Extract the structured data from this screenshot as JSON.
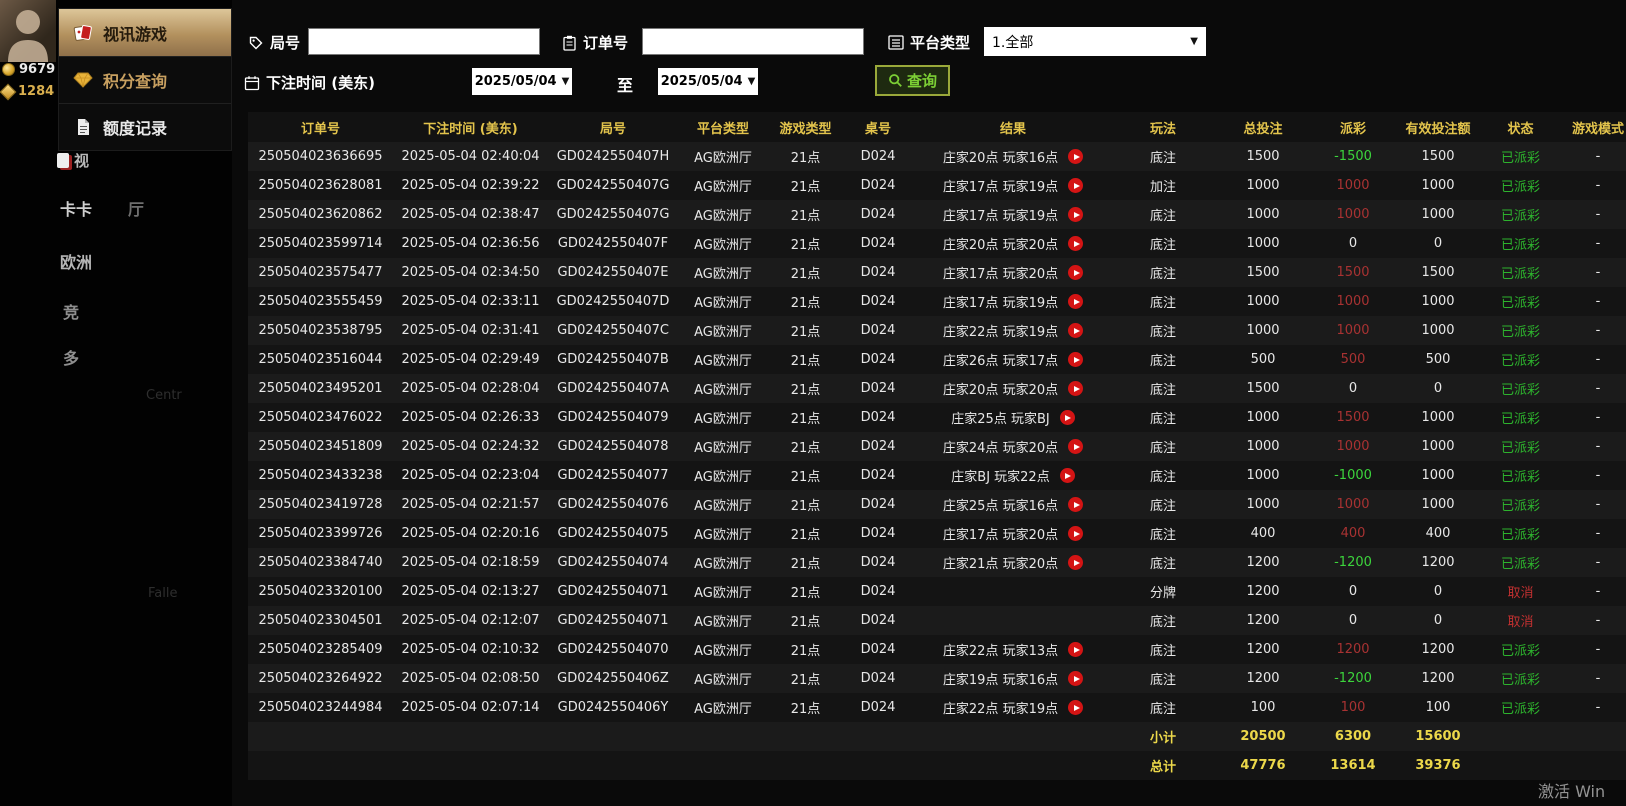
{
  "background": {
    "balances": [
      {
        "icon": "coin-icon",
        "value": "9679"
      },
      {
        "icon": "gem-icon",
        "value": "1284"
      }
    ],
    "nav_fragments": [
      "视",
      "卡卡",
      "厅",
      "欧洲",
      "竞",
      "多"
    ],
    "faint_fragments": [
      "Centr",
      "Falle"
    ]
  },
  "sidebar": {
    "items": [
      {
        "label": "视讯游戏",
        "icon": "cards-icon",
        "active": true
      },
      {
        "label": "积分查询",
        "icon": "diamond-icon",
        "active": false
      },
      {
        "label": "额度记录",
        "icon": "document-icon",
        "active": false
      }
    ]
  },
  "filters": {
    "round": {
      "label": "局号",
      "value": "",
      "icon": "tag-icon"
    },
    "order": {
      "label": "订单号",
      "value": "",
      "icon": "clipboard-icon"
    },
    "platform": {
      "label": "平台类型",
      "value": "1.全部",
      "icon": "list-icon"
    },
    "bet_time": {
      "label": "下注时间 (美东)",
      "icon": "calendar-icon"
    },
    "date_from": "2025/05/04",
    "to_label": "至",
    "date_to": "2025/05/04",
    "search": {
      "label": "查询",
      "icon": "search-icon"
    }
  },
  "table": {
    "headers": [
      "订单号",
      "下注时间 (美东)",
      "局号",
      "平台类型",
      "游戏类型",
      "桌号",
      "结果",
      "玩法",
      "总投注",
      "派彩",
      "有效投注额",
      "状态",
      "游戏模式"
    ],
    "rows": [
      {
        "order": "250504023636695",
        "time": "2025-05-04 02:40:04",
        "round": "GD0242550407H",
        "platform": "AG欧洲厅",
        "game": "21点",
        "table_no": "D024",
        "result": "庄家20点 玩家16点",
        "replay": true,
        "play": "底注",
        "total_bet": "1500",
        "payout": "-1500",
        "payout_class": "loss",
        "valid_bet": "1500",
        "status": "已派彩",
        "status_class": "paid",
        "mode": "-"
      },
      {
        "order": "250504023628081",
        "time": "2025-05-04 02:39:22",
        "round": "GD0242550407G",
        "platform": "AG欧洲厅",
        "game": "21点",
        "table_no": "D024",
        "result": "庄家17点 玩家19点",
        "replay": true,
        "play": "加注",
        "total_bet": "1000",
        "payout": "1000",
        "payout_class": "win",
        "valid_bet": "1000",
        "status": "已派彩",
        "status_class": "paid",
        "mode": "-"
      },
      {
        "order": "250504023620862",
        "time": "2025-05-04 02:38:47",
        "round": "GD0242550407G",
        "platform": "AG欧洲厅",
        "game": "21点",
        "table_no": "D024",
        "result": "庄家17点 玩家19点",
        "replay": true,
        "play": "底注",
        "total_bet": "1000",
        "payout": "1000",
        "payout_class": "win",
        "valid_bet": "1000",
        "status": "已派彩",
        "status_class": "paid",
        "mode": "-"
      },
      {
        "order": "250504023599714",
        "time": "2025-05-04 02:36:56",
        "round": "GD0242550407F",
        "platform": "AG欧洲厅",
        "game": "21点",
        "table_no": "D024",
        "result": "庄家20点 玩家20点",
        "replay": true,
        "play": "底注",
        "total_bet": "1000",
        "payout": "0",
        "payout_class": "zero",
        "valid_bet": "0",
        "status": "已派彩",
        "status_class": "paid",
        "mode": "-"
      },
      {
        "order": "250504023575477",
        "time": "2025-05-04 02:34:50",
        "round": "GD0242550407E",
        "platform": "AG欧洲厅",
        "game": "21点",
        "table_no": "D024",
        "result": "庄家17点 玩家20点",
        "replay": true,
        "play": "底注",
        "total_bet": "1500",
        "payout": "1500",
        "payout_class": "win",
        "valid_bet": "1500",
        "status": "已派彩",
        "status_class": "paid",
        "mode": "-"
      },
      {
        "order": "250504023555459",
        "time": "2025-05-04 02:33:11",
        "round": "GD0242550407D",
        "platform": "AG欧洲厅",
        "game": "21点",
        "table_no": "D024",
        "result": "庄家17点 玩家19点",
        "replay": true,
        "play": "底注",
        "total_bet": "1000",
        "payout": "1000",
        "payout_class": "win",
        "valid_bet": "1000",
        "status": "已派彩",
        "status_class": "paid",
        "mode": "-"
      },
      {
        "order": "250504023538795",
        "time": "2025-05-04 02:31:41",
        "round": "GD0242550407C",
        "platform": "AG欧洲厅",
        "game": "21点",
        "table_no": "D024",
        "result": "庄家22点 玩家19点",
        "replay": true,
        "play": "底注",
        "total_bet": "1000",
        "payout": "1000",
        "payout_class": "win",
        "valid_bet": "1000",
        "status": "已派彩",
        "status_class": "paid",
        "mode": "-"
      },
      {
        "order": "250504023516044",
        "time": "2025-05-04 02:29:49",
        "round": "GD0242550407B",
        "platform": "AG欧洲厅",
        "game": "21点",
        "table_no": "D024",
        "result": "庄家26点 玩家17点",
        "replay": true,
        "play": "底注",
        "total_bet": "500",
        "payout": "500",
        "payout_class": "win",
        "valid_bet": "500",
        "status": "已派彩",
        "status_class": "paid",
        "mode": "-"
      },
      {
        "order": "250504023495201",
        "time": "2025-05-04 02:28:04",
        "round": "GD0242550407A",
        "platform": "AG欧洲厅",
        "game": "21点",
        "table_no": "D024",
        "result": "庄家20点 玩家20点",
        "replay": true,
        "play": "底注",
        "total_bet": "1500",
        "payout": "0",
        "payout_class": "zero",
        "valid_bet": "0",
        "status": "已派彩",
        "status_class": "paid",
        "mode": "-"
      },
      {
        "order": "250504023476022",
        "time": "2025-05-04 02:26:33",
        "round": "GD02425504079",
        "platform": "AG欧洲厅",
        "game": "21点",
        "table_no": "D024",
        "result": "庄家25点 玩家BJ",
        "replay": true,
        "play": "底注",
        "total_bet": "1000",
        "payout": "1500",
        "payout_class": "win",
        "valid_bet": "1000",
        "status": "已派彩",
        "status_class": "paid",
        "mode": "-"
      },
      {
        "order": "250504023451809",
        "time": "2025-05-04 02:24:32",
        "round": "GD02425504078",
        "platform": "AG欧洲厅",
        "game": "21点",
        "table_no": "D024",
        "result": "庄家24点 玩家20点",
        "replay": true,
        "play": "底注",
        "total_bet": "1000",
        "payout": "1000",
        "payout_class": "win",
        "valid_bet": "1000",
        "status": "已派彩",
        "status_class": "paid",
        "mode": "-"
      },
      {
        "order": "250504023433238",
        "time": "2025-05-04 02:23:04",
        "round": "GD02425504077",
        "platform": "AG欧洲厅",
        "game": "21点",
        "table_no": "D024",
        "result": "庄家BJ 玩家22点",
        "replay": true,
        "play": "底注",
        "total_bet": "1000",
        "payout": "-1000",
        "payout_class": "loss",
        "valid_bet": "1000",
        "status": "已派彩",
        "status_class": "paid",
        "mode": "-"
      },
      {
        "order": "250504023419728",
        "time": "2025-05-04 02:21:57",
        "round": "GD02425504076",
        "platform": "AG欧洲厅",
        "game": "21点",
        "table_no": "D024",
        "result": "庄家25点 玩家16点",
        "replay": true,
        "play": "底注",
        "total_bet": "1000",
        "payout": "1000",
        "payout_class": "win",
        "valid_bet": "1000",
        "status": "已派彩",
        "status_class": "paid",
        "mode": "-"
      },
      {
        "order": "250504023399726",
        "time": "2025-05-04 02:20:16",
        "round": "GD02425504075",
        "platform": "AG欧洲厅",
        "game": "21点",
        "table_no": "D024",
        "result": "庄家17点 玩家20点",
        "replay": true,
        "play": "底注",
        "total_bet": "400",
        "payout": "400",
        "payout_class": "win",
        "valid_bet": "400",
        "status": "已派彩",
        "status_class": "paid",
        "mode": "-"
      },
      {
        "order": "250504023384740",
        "time": "2025-05-04 02:18:59",
        "round": "GD02425504074",
        "platform": "AG欧洲厅",
        "game": "21点",
        "table_no": "D024",
        "result": "庄家21点 玩家20点",
        "replay": true,
        "play": "底注",
        "total_bet": "1200",
        "payout": "-1200",
        "payout_class": "loss",
        "valid_bet": "1200",
        "status": "已派彩",
        "status_class": "paid",
        "mode": "-"
      },
      {
        "order": "250504023320100",
        "time": "2025-05-04 02:13:27",
        "round": "GD02425504071",
        "platform": "AG欧洲厅",
        "game": "21点",
        "table_no": "D024",
        "result": "",
        "replay": false,
        "play": "分牌",
        "total_bet": "1200",
        "payout": "0",
        "payout_class": "zero",
        "valid_bet": "0",
        "status": "取消",
        "status_class": "cancelled",
        "mode": "-"
      },
      {
        "order": "250504023304501",
        "time": "2025-05-04 02:12:07",
        "round": "GD02425504071",
        "platform": "AG欧洲厅",
        "game": "21点",
        "table_no": "D024",
        "result": "",
        "replay": false,
        "play": "底注",
        "total_bet": "1200",
        "payout": "0",
        "payout_class": "zero",
        "valid_bet": "0",
        "status": "取消",
        "status_class": "cancelled",
        "mode": "-"
      },
      {
        "order": "250504023285409",
        "time": "2025-05-04 02:10:32",
        "round": "GD02425504070",
        "platform": "AG欧洲厅",
        "game": "21点",
        "table_no": "D024",
        "result": "庄家22点 玩家13点",
        "replay": true,
        "play": "底注",
        "total_bet": "1200",
        "payout": "1200",
        "payout_class": "win",
        "valid_bet": "1200",
        "status": "已派彩",
        "status_class": "paid",
        "mode": "-"
      },
      {
        "order": "250504023264922",
        "time": "2025-05-04 02:08:50",
        "round": "GD0242550406Z",
        "platform": "AG欧洲厅",
        "game": "21点",
        "table_no": "D024",
        "result": "庄家19点 玩家16点",
        "replay": true,
        "play": "底注",
        "total_bet": "1200",
        "payout": "-1200",
        "payout_class": "loss",
        "valid_bet": "1200",
        "status": "已派彩",
        "status_class": "paid",
        "mode": "-"
      },
      {
        "order": "250504023244984",
        "time": "2025-05-04 02:07:14",
        "round": "GD0242550406Y",
        "platform": "AG欧洲厅",
        "game": "21点",
        "table_no": "D024",
        "result": "庄家22点 玩家19点",
        "replay": true,
        "play": "底注",
        "total_bet": "100",
        "payout": "100",
        "payout_class": "win",
        "valid_bet": "100",
        "status": "已派彩",
        "status_class": "paid",
        "mode": "-"
      }
    ],
    "subtotal": {
      "label": "小计",
      "total_bet": "20500",
      "payout": "6300",
      "valid_bet": "15600"
    },
    "total": {
      "label": "总计",
      "total_bet": "47776",
      "payout": "13614",
      "valid_bet": "39376"
    }
  },
  "watermark": "激活 Win",
  "colors": {
    "header_yellow": "#e3c44c",
    "win_red": "#a83232",
    "loss_green": "#3cd43c",
    "paid_green": "#2db32d",
    "cancel_red": "#c03030",
    "summary_yellow": "#ecd84a",
    "active_tab_tan": "#b3915e",
    "search_button_green": "#7ccf35"
  }
}
